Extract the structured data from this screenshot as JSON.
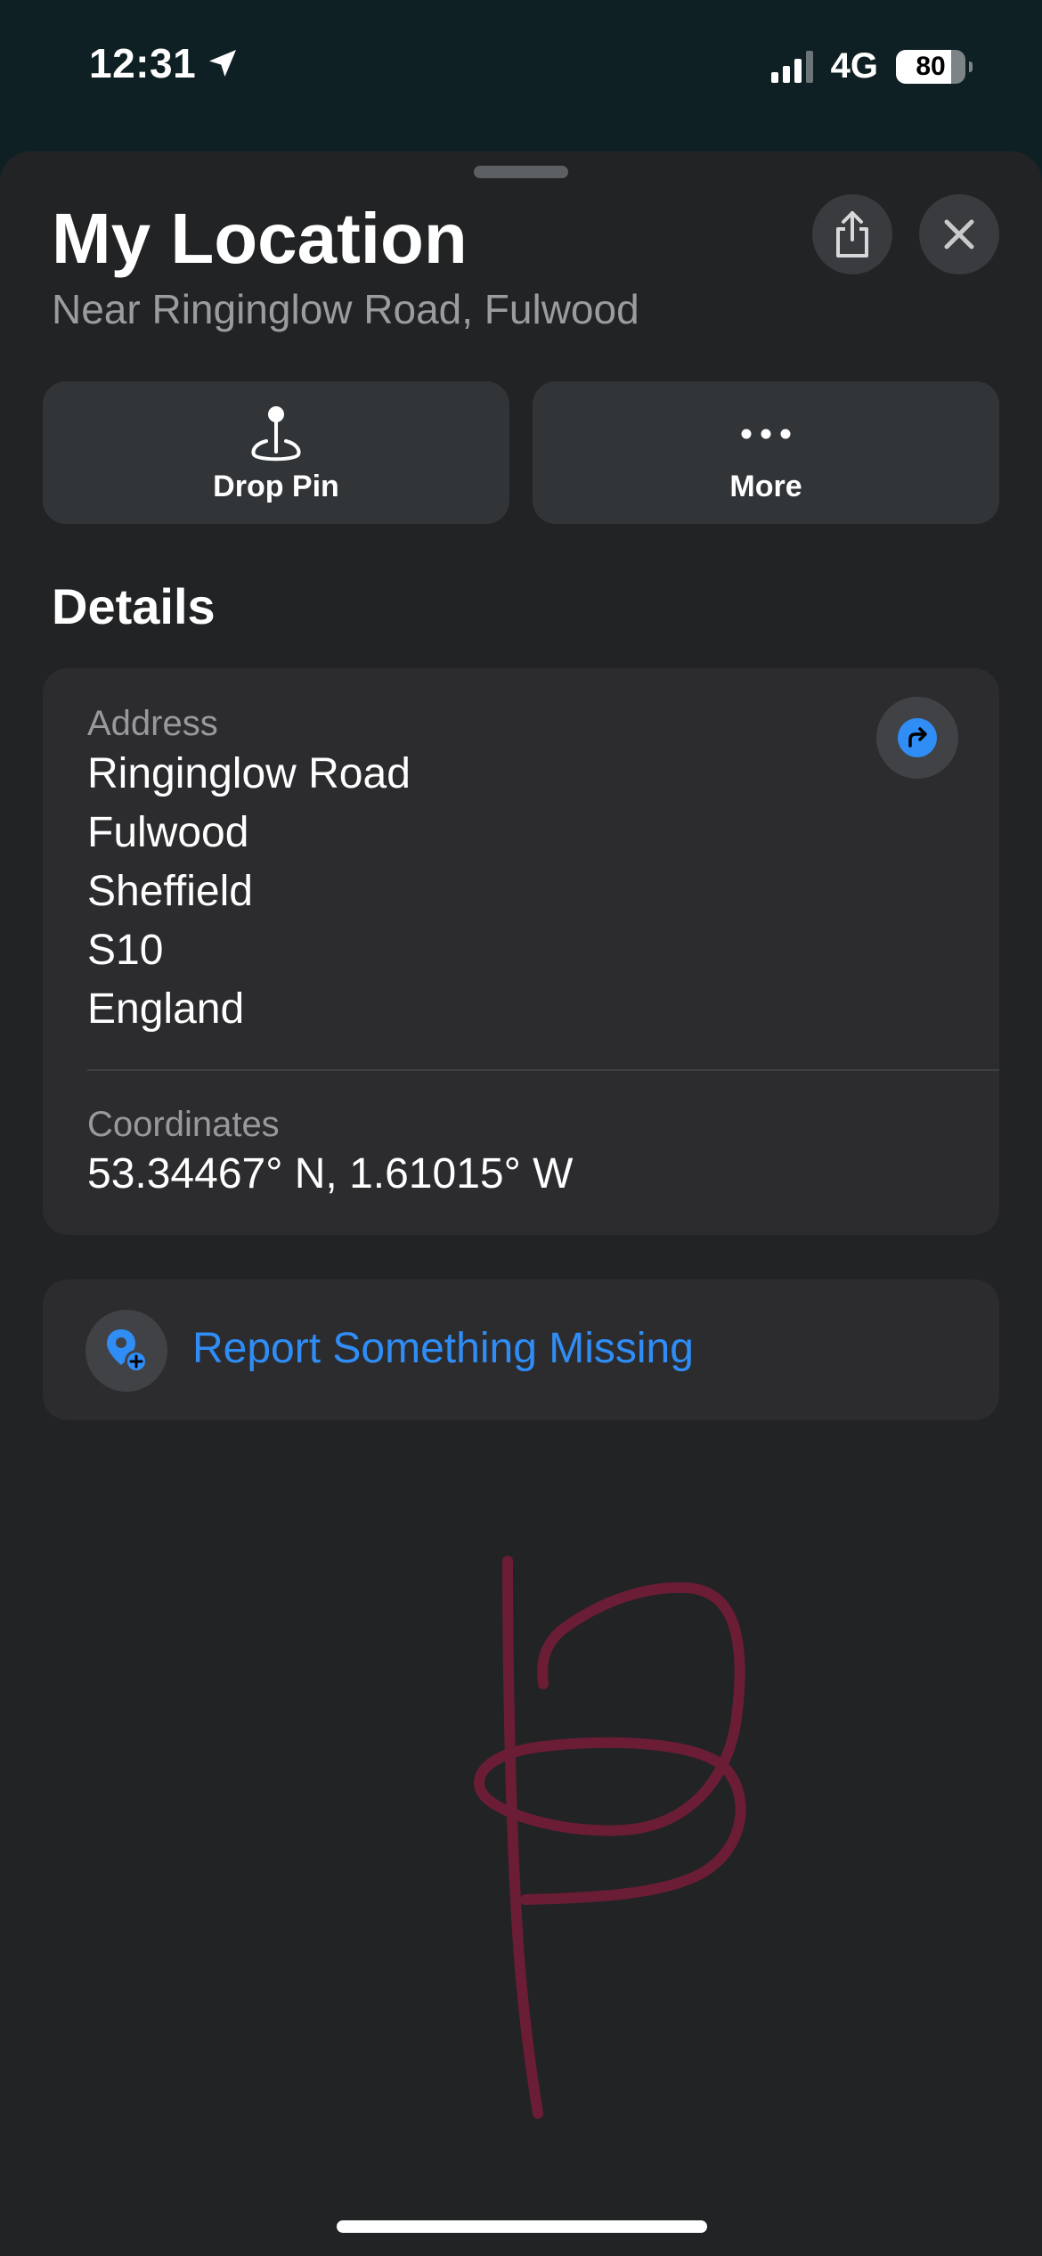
{
  "status_bar": {
    "time": "12:31",
    "network": "4G",
    "battery_level": "80",
    "battery_fraction": 0.8,
    "signal_bars_active": 3,
    "signal_bars_total": 4,
    "location_icon": "location-arrow-icon"
  },
  "sheet": {
    "title": "My Location",
    "subtitle": "Near Ringinglow Road, Fulwood",
    "share_icon": "share-icon",
    "close_icon": "close-icon"
  },
  "actions": [
    {
      "label": "Drop Pin",
      "icon": "drop-pin-icon"
    },
    {
      "label": "More",
      "icon": "more-dots-icon"
    }
  ],
  "details": {
    "heading": "Details",
    "address_label": "Address",
    "address_lines": [
      "Ringinglow Road",
      "Fulwood",
      "Sheffield",
      "S10",
      "England"
    ],
    "directions_icon": "directions-icon",
    "coordinates_label": "Coordinates",
    "coordinates_value": "53.34467° N, 1.61015° W"
  },
  "report": {
    "label": "Report Something Missing",
    "icon": "report-missing-icon"
  },
  "colors": {
    "accent": "#2f8df5",
    "sheet_background": "#212325",
    "card_background": "#2c2c2f",
    "doodle": "#6b1d36"
  }
}
